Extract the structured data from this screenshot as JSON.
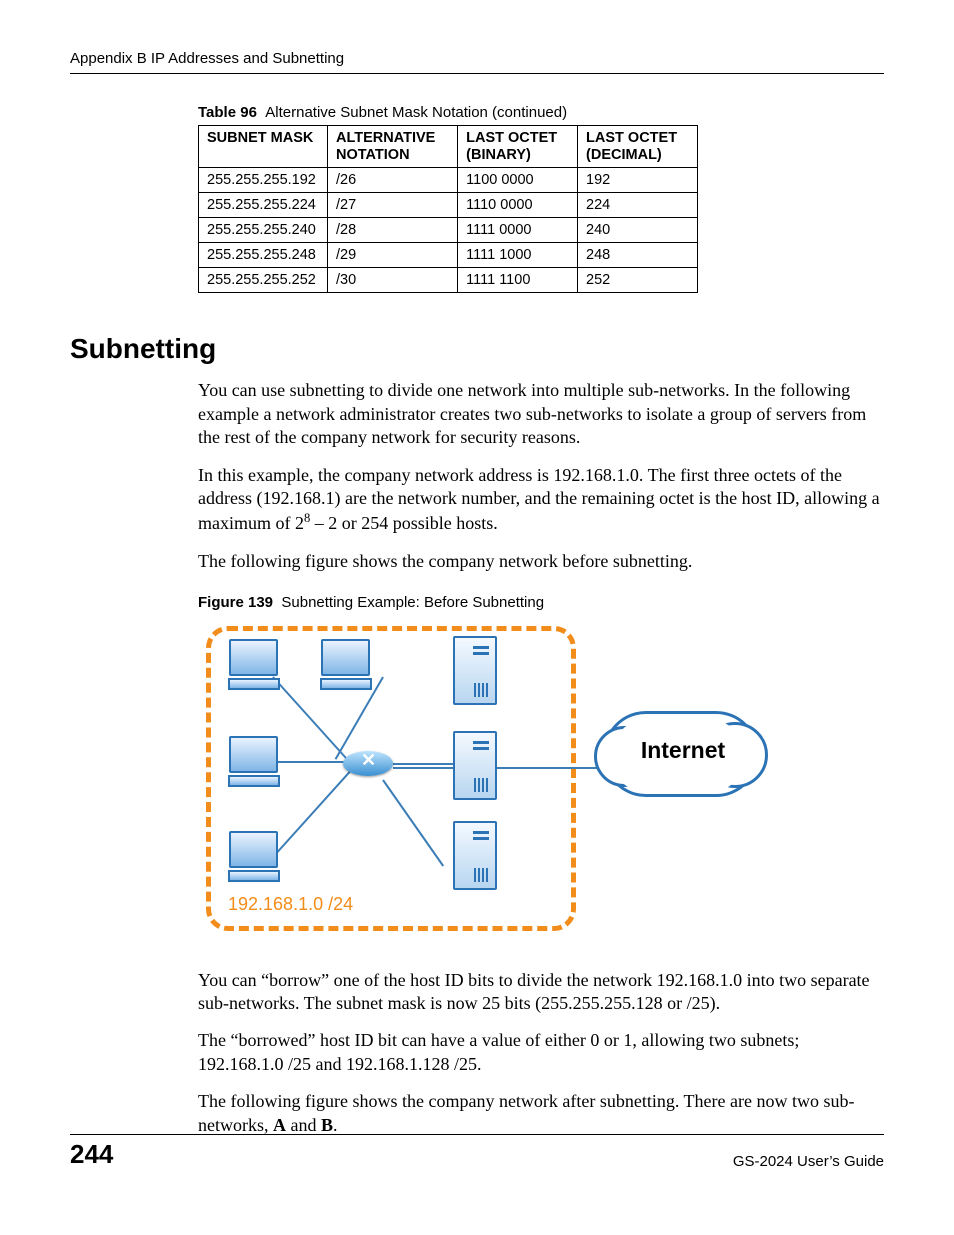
{
  "header": "Appendix B IP Addresses and Subnetting",
  "table": {
    "caption_label": "Table 96",
    "caption_text": "Alternative Subnet Mask Notation (continued)",
    "headers": [
      "SUBNET MASK",
      "ALTERNATIVE NOTATION",
      "LAST OCTET (BINARY)",
      "LAST OCTET (DECIMAL)"
    ],
    "rows": [
      [
        "255.255.255.192",
        "/26",
        "1100 0000",
        "192"
      ],
      [
        "255.255.255.224",
        "/27",
        "1110 0000",
        "224"
      ],
      [
        "255.255.255.240",
        "/28",
        "1111 0000",
        "240"
      ],
      [
        "255.255.255.248",
        "/29",
        "1111 1000",
        "248"
      ],
      [
        "255.255.255.252",
        "/30",
        "1111 1100",
        "252"
      ]
    ]
  },
  "section_title": "Subnetting",
  "para1": "You can use subnetting to divide one network into multiple sub-networks. In the following example a network administrator creates two sub-networks to isolate a group of servers from the rest of the company network for security reasons.",
  "para2a": "In this example, the company network address is 192.168.1.0. The first three octets of the address (192.168.1) are the network number, and the remaining octet is the host ID, allowing a maximum of 2",
  "para2_exp": "8",
  "para2b": " – 2 or 254 possible hosts.",
  "para3": "The following figure shows the company network before subnetting.",
  "figure": {
    "caption_label": "Figure 139",
    "caption_text": "Subnetting Example: Before Subnetting",
    "net_label": "192.168.1.0 /24",
    "cloud_label": "Internet"
  },
  "para4": "You can “borrow” one of the host ID bits to divide the network 192.168.1.0 into two separate sub-networks. The subnet mask is now 25 bits (255.255.255.128 or /25).",
  "para5": "The “borrowed” host ID bit can have a value of either 0 or 1, allowing two subnets; 192.168.1.0 /25 and 192.168.1.128 /25.",
  "para6a": "The following figure shows the company network after subnetting. There are now two sub-networks, ",
  "para6_A": "A",
  "para6_mid": " and ",
  "para6_B": "B",
  "para6_end": ".",
  "footer": {
    "page": "244",
    "guide": "GS-2024 User’s Guide"
  }
}
